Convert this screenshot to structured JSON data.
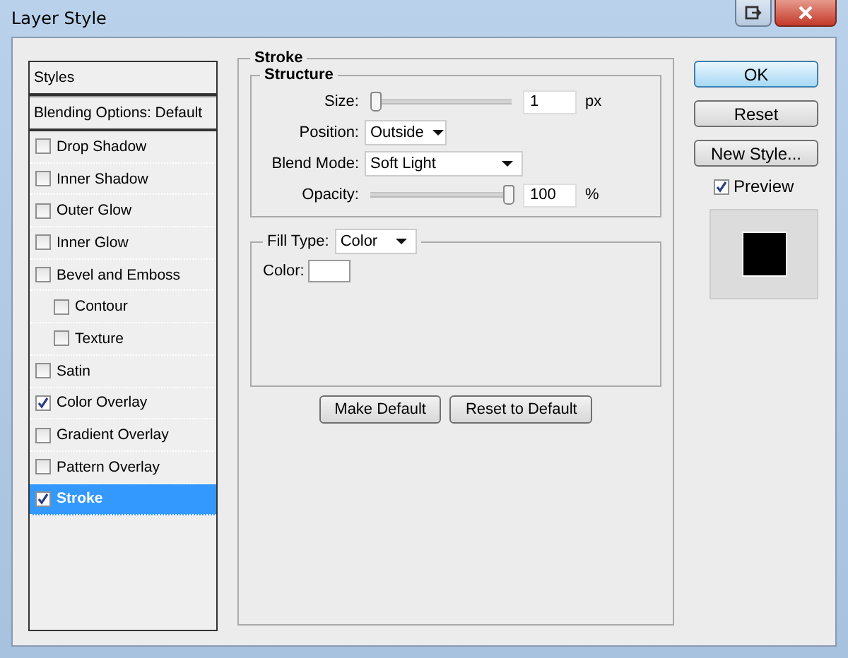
{
  "window": {
    "title": "Layer Style"
  },
  "styles": {
    "header": "Styles",
    "blending": "Blending Options: Default",
    "items": [
      {
        "label": "Drop Shadow",
        "checked": false,
        "selected": false
      },
      {
        "label": "Inner Shadow",
        "checked": false,
        "selected": false
      },
      {
        "label": "Outer Glow",
        "checked": false,
        "selected": false
      },
      {
        "label": "Inner Glow",
        "checked": false,
        "selected": false
      },
      {
        "label": "Bevel and Emboss",
        "checked": false,
        "selected": false,
        "children": [
          {
            "label": "Contour",
            "checked": false,
            "selected": false
          },
          {
            "label": "Texture",
            "checked": false,
            "selected": false
          }
        ]
      },
      {
        "label": "Satin",
        "checked": false,
        "selected": false
      },
      {
        "label": "Color Overlay",
        "checked": true,
        "selected": false
      },
      {
        "label": "Gradient Overlay",
        "checked": false,
        "selected": false
      },
      {
        "label": "Pattern Overlay",
        "checked": false,
        "selected": false
      },
      {
        "label": "Stroke",
        "checked": true,
        "selected": true
      }
    ]
  },
  "stroke": {
    "title": "Stroke",
    "structure": {
      "title": "Structure",
      "size": {
        "label": "Size:",
        "level": 0,
        "value": "1",
        "unit": "px"
      },
      "position": {
        "label": "Position:",
        "value": "Outside"
      },
      "blend_mode": {
        "label": "Blend Mode:",
        "value": "Soft Light"
      },
      "opacity": {
        "label": "Opacity:",
        "level": 1,
        "value": "100",
        "unit": "%"
      }
    },
    "fill_type": {
      "label": "Fill Type:",
      "value": "Color"
    },
    "color": {
      "label": "Color:"
    },
    "buttons": [
      "Make Default",
      "Reset to Default"
    ]
  },
  "actions": [
    "OK",
    "Reset",
    "New Style..."
  ],
  "preview": {
    "label": "Preview",
    "checked": true
  }
}
